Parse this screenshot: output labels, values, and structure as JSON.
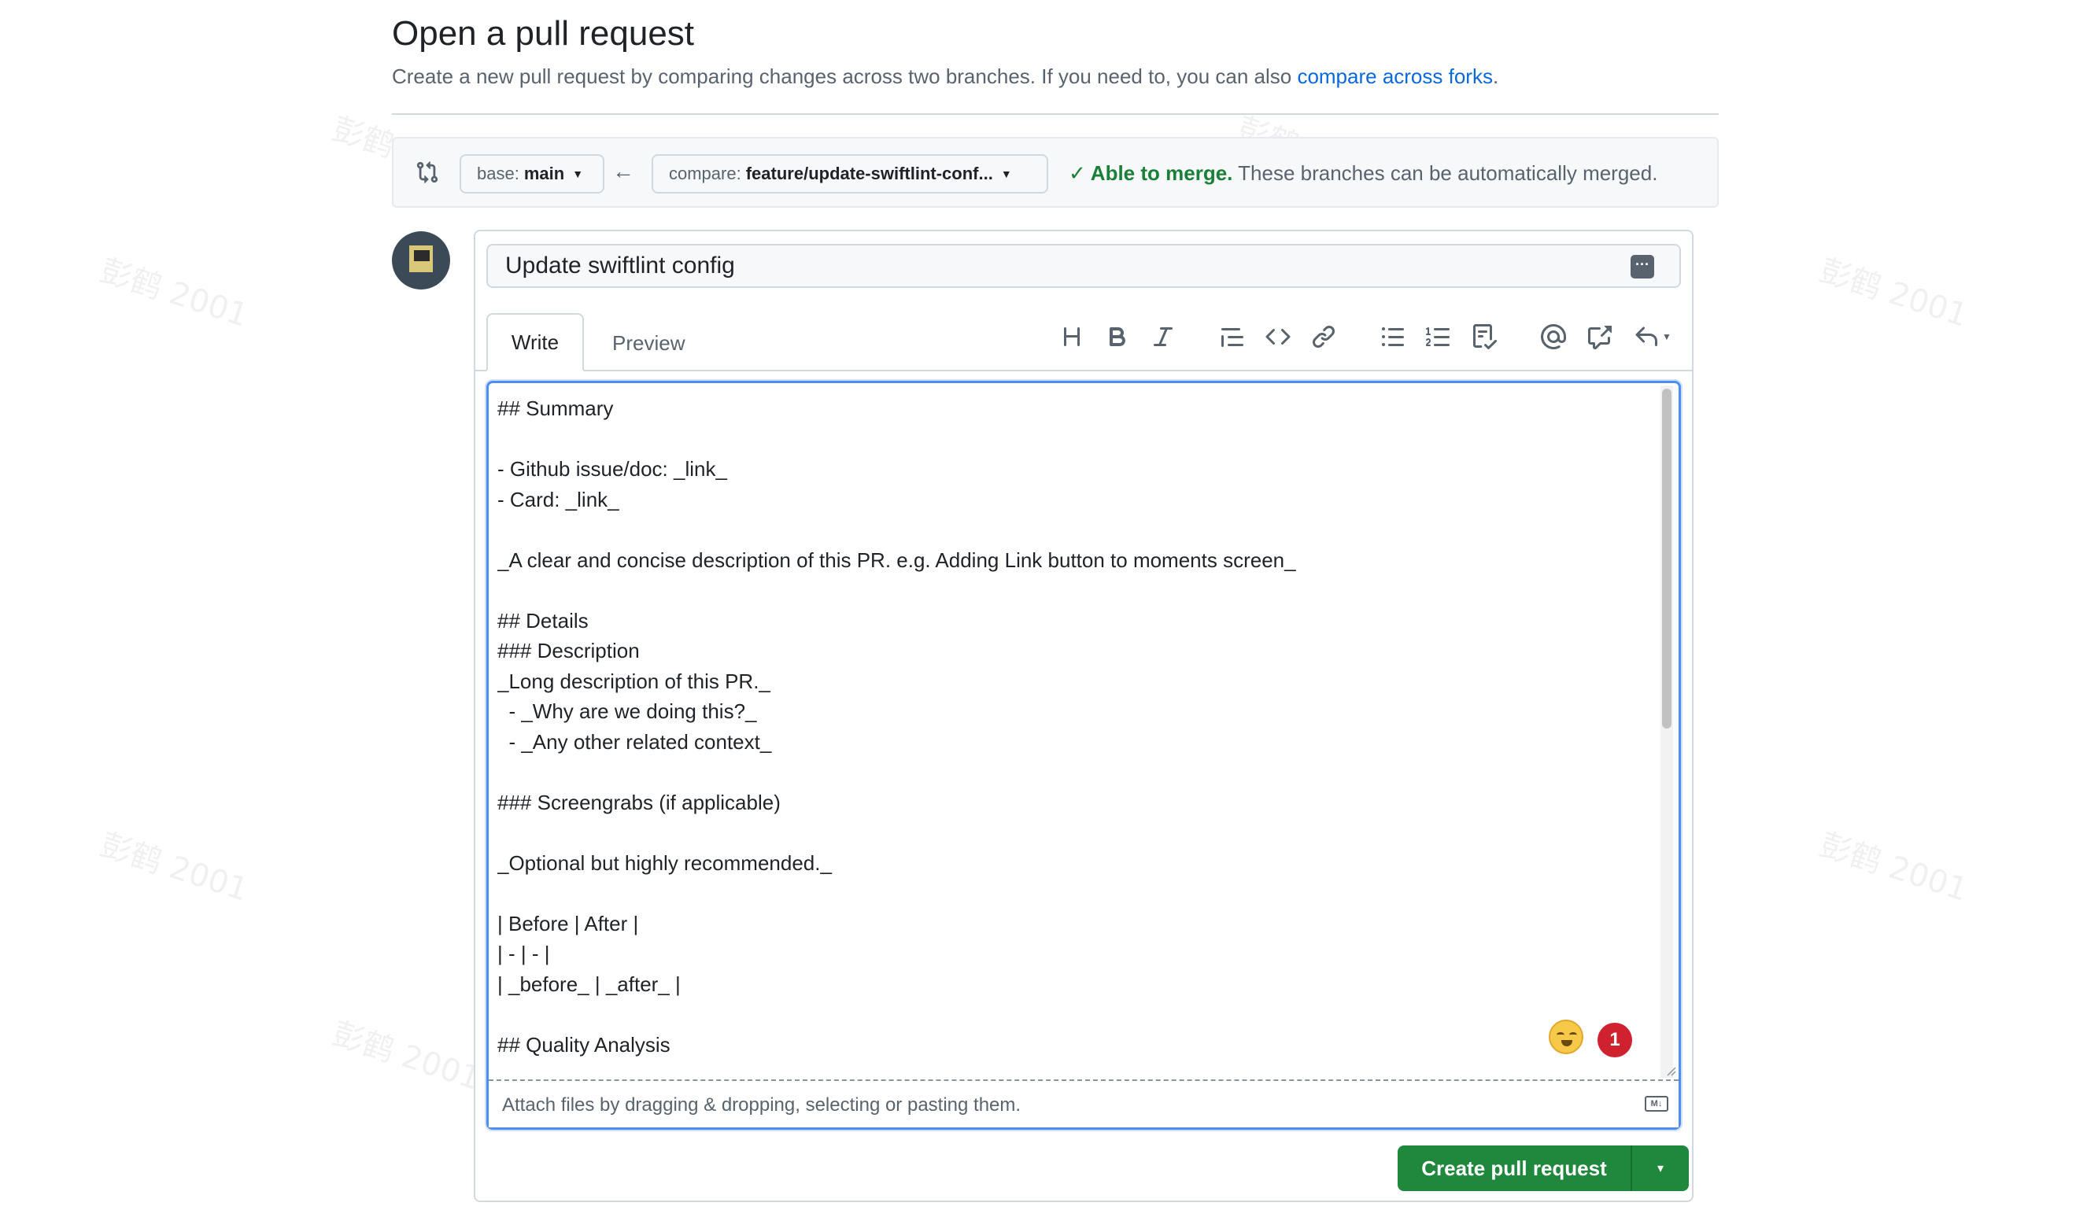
{
  "header": {
    "title": "Open a pull request",
    "description": "Create a new pull request by comparing changes across two branches. If you need to, you can also ",
    "compare_link": "compare across forks",
    "description_end": "."
  },
  "range": {
    "icon": "git-compare-icon",
    "base_key": "base:",
    "base_value": "main",
    "arrow": "←",
    "compare_key": "compare:",
    "compare_value": "feature/update-swiftlint-conf...",
    "merge_check": "✓",
    "merge_ok": "Able to merge.",
    "merge_text": "These branches can be automatically merged."
  },
  "form": {
    "title_value": "Update swiftlint config",
    "title_menu": "···",
    "tabs": {
      "write": "Write",
      "preview": "Preview"
    },
    "toolbar": [
      "heading-icon",
      "bold-icon",
      "italic-icon",
      "quote-icon",
      "code-icon",
      "link-icon",
      "unordered-list-icon",
      "ordered-list-icon",
      "task-list-icon",
      "mention-icon",
      "cross-reference-icon",
      "saved-replies-icon"
    ],
    "body": "## Summary\n\n- Github issue/doc: _link_\n- Card: _link_\n\n_A clear and concise description of this PR. e.g. Adding Link button to moments screen_\n\n## Details\n### Description\n_Long description of this PR._\n  - _Why are we doing this?_\n  - _Any other related context_\n\n### Screengrabs (if applicable)\n\n_Optional but highly recommended._\n\n| Before | After |\n| - | - |\n| _before_ | _after_ |\n\n## Quality Analysis",
    "notification_count": "1",
    "attach_text": "Attach files by dragging & dropping, selecting or pasting them.",
    "markdown_badge": "M↓"
  },
  "submit": {
    "label": "Create pull request",
    "dropdown": "▾"
  },
  "watermark": "彭鹤 2001",
  "colors": {
    "accent": "#0969da",
    "success": "#1a7f37",
    "button": "#1f883d",
    "badge": "#cf222e"
  }
}
